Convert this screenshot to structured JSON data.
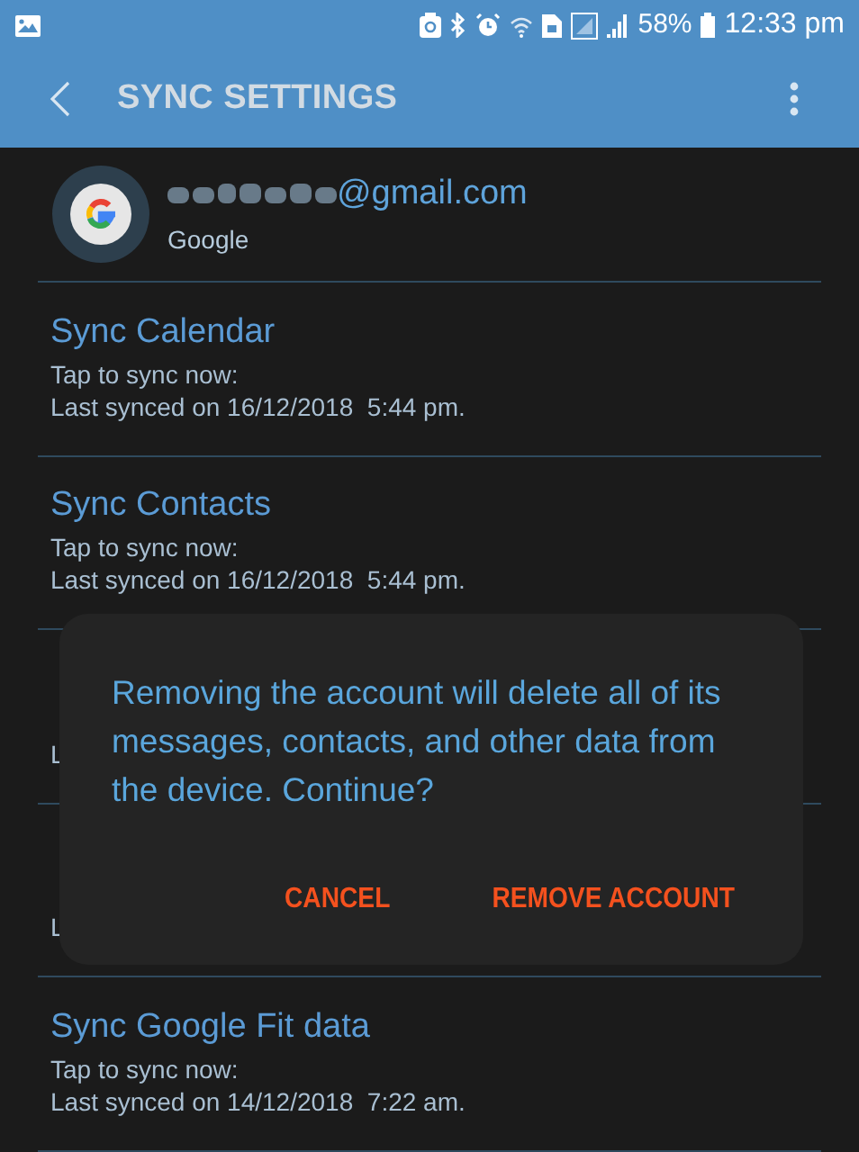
{
  "status_bar": {
    "battery": "58%",
    "time": "12:33 pm"
  },
  "app_bar": {
    "title": "SYNC SETTINGS"
  },
  "account": {
    "email": "@gmail.com",
    "provider": "Google"
  },
  "sync_items": [
    {
      "title": "Sync Calendar",
      "line1": "Tap to sync now:",
      "line2": "Last synced on 16/12/2018  5:44 pm."
    },
    {
      "title": "Sync Contacts",
      "line1": "Tap to sync now:",
      "line2": "Last synced on 16/12/2018  5:44 pm."
    },
    {
      "line2": "L"
    },
    {
      "line2": "L"
    },
    {
      "title": "Sync Google Fit data",
      "line1": "Tap to sync now:",
      "line2": "Last synced on 14/12/2018  7:22 am."
    }
  ],
  "dialog": {
    "message": "Removing the account will delete all of its messages, contacts, and other data from the device. Continue?",
    "buttons": [
      "CANCEL",
      "REMOVE ACCOUNT"
    ]
  }
}
